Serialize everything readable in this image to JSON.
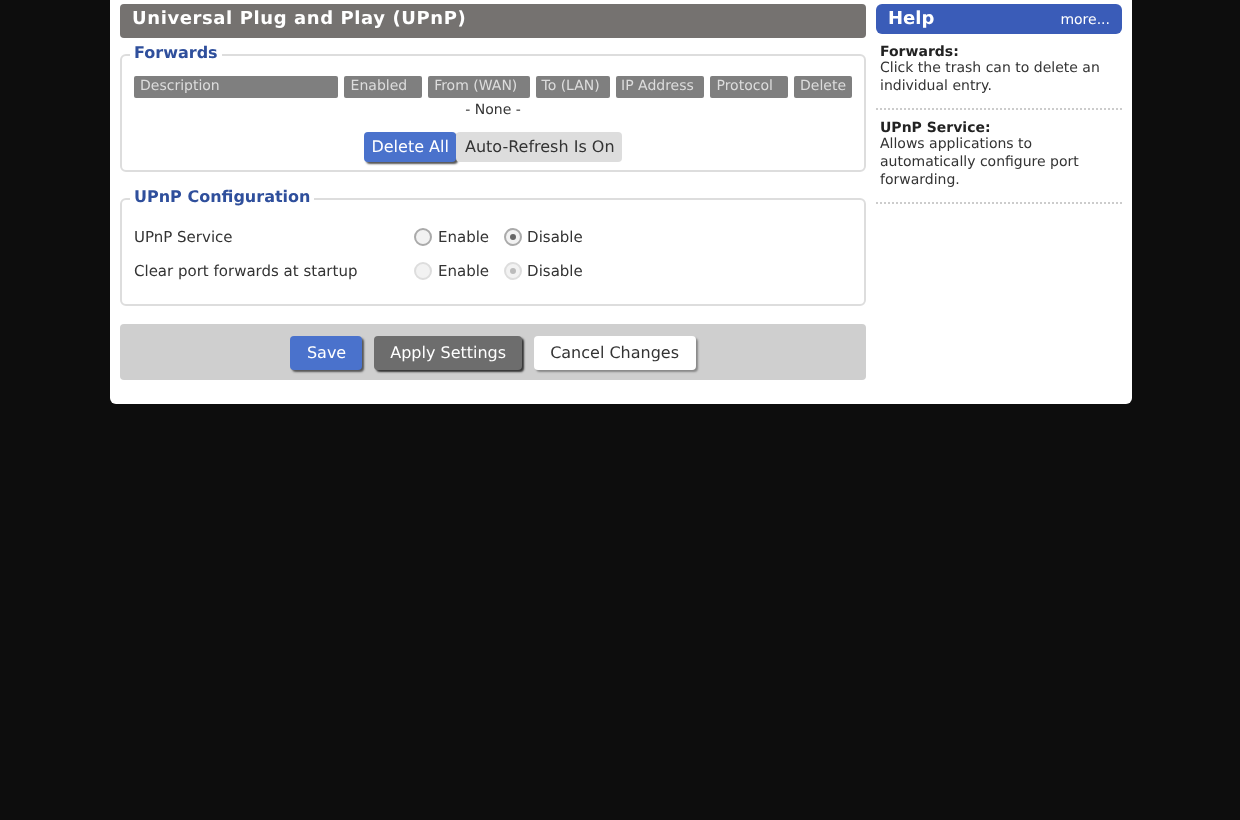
{
  "section_title": "Universal Plug and Play (UPnP)",
  "forwards": {
    "legend": "Forwards",
    "columns": [
      "Description",
      "Enabled",
      "From (WAN)",
      "To (LAN)",
      "IP Address",
      "Protocol",
      "Delete"
    ],
    "empty_text": "- None -",
    "buttons": [
      {
        "label": "Delete All",
        "kind": "primary"
      },
      {
        "label": "Auto-Refresh Is On",
        "kind": "toggle"
      }
    ]
  },
  "config": {
    "legend": "UPnP Configuration",
    "rows": [
      {
        "label": "UPnP Service",
        "disabled": false,
        "options": [
          {
            "label": "Enable",
            "selected": false
          },
          {
            "label": "Disable",
            "selected": true
          }
        ]
      },
      {
        "label": "Clear port forwards at startup",
        "disabled": true,
        "options": [
          {
            "label": "Enable",
            "selected": false
          },
          {
            "label": "Disable",
            "selected": true
          }
        ]
      }
    ]
  },
  "actions": [
    {
      "label": "Save",
      "kind": "primary"
    },
    {
      "label": "Apply Settings",
      "kind": "dark"
    },
    {
      "label": "Cancel Changes",
      "kind": "plain"
    }
  ],
  "help": {
    "title": "Help",
    "more": "more...",
    "entries": [
      {
        "heading": "Forwards:",
        "text": "Click the trash can to delete an individual entry."
      },
      {
        "heading": "UPnP Service:",
        "text": "Allows applications to automatically configure port forwarding."
      }
    ]
  }
}
